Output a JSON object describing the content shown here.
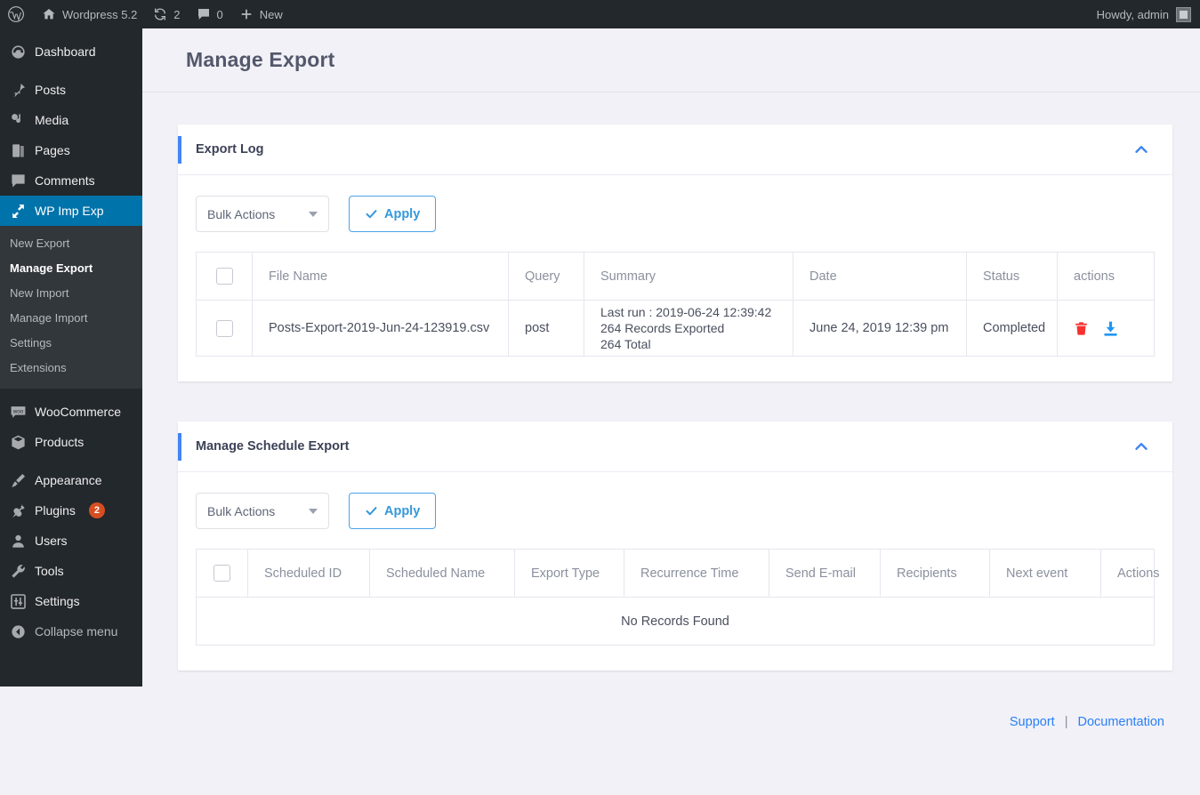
{
  "adminbar": {
    "logo_icon": "wordpress-logo-icon",
    "site_name": "Wordpress 5.2",
    "home_icon": "home-icon",
    "updates_icon": "updates-icon",
    "updates_count": "2",
    "comments_icon": "comment-icon",
    "comments_count": "0",
    "new_icon": "plus-icon",
    "new_label": "New",
    "howdy": "Howdy, admin",
    "avatar_icon": "avatar-icon"
  },
  "sidebar": {
    "items": [
      {
        "label": "Dashboard",
        "icon": "dashboard-icon"
      },
      {
        "label": "Posts",
        "icon": "pin-icon"
      },
      {
        "label": "Media",
        "icon": "media-icon"
      },
      {
        "label": "Pages",
        "icon": "pages-icon"
      },
      {
        "label": "Comments",
        "icon": "comment-icon"
      },
      {
        "label": "WP Imp Exp",
        "icon": "import-export-icon"
      },
      {
        "label": "WooCommerce",
        "icon": "woocommerce-icon"
      },
      {
        "label": "Products",
        "icon": "box-icon"
      },
      {
        "label": "Appearance",
        "icon": "brush-icon"
      },
      {
        "label": "Plugins",
        "icon": "plug-icon",
        "badge": "2"
      },
      {
        "label": "Users",
        "icon": "user-icon"
      },
      {
        "label": "Tools",
        "icon": "wrench-icon"
      },
      {
        "label": "Settings",
        "icon": "settings-icon"
      },
      {
        "label": "Collapse menu",
        "icon": "collapse-icon"
      }
    ],
    "submenu": [
      {
        "label": "New Export",
        "active": false
      },
      {
        "label": "Manage Export",
        "active": true
      },
      {
        "label": "New Import",
        "active": false
      },
      {
        "label": "Manage Import",
        "active": false
      },
      {
        "label": "Settings",
        "active": false
      },
      {
        "label": "Extensions",
        "active": false
      }
    ]
  },
  "header": {
    "title": "Manage Export"
  },
  "colors": {
    "accent_blue": "#4285f4",
    "link_blue": "#2a7ff6",
    "button_blue": "#3498db",
    "delete_red": "#f8312f",
    "download_blue": "#2196f3",
    "admin_dark": "#23282d",
    "menu_active": "#0073aa",
    "badge_orange": "#d54e21"
  },
  "export_log": {
    "title": "Export Log",
    "collapse_icon": "chevron-up-icon",
    "bulk_actions_label": "Bulk Actions",
    "dropdown_icon": "chevron-down-icon",
    "apply_label": "Apply",
    "apply_icon": "check-icon",
    "select_all_icon": "checkbox-icon",
    "columns": [
      "File Name",
      "Query",
      "Summary",
      "Date",
      "Status",
      "actions"
    ],
    "rows": [
      {
        "file_name": "Posts-Export-2019-Jun-24-123919.csv",
        "query": "post",
        "summary_line1": "Last run : 2019-06-24 12:39:42",
        "summary_line2": "264 Records Exported",
        "summary_line3": "264 Total",
        "date": "June 24, 2019 12:39 pm",
        "status": "Completed",
        "delete_icon": "trash-icon",
        "download_icon": "download-icon"
      }
    ]
  },
  "schedule_export": {
    "title": "Manage Schedule Export",
    "collapse_icon": "chevron-up-icon",
    "bulk_actions_label": "Bulk Actions",
    "dropdown_icon": "chevron-down-icon",
    "apply_label": "Apply",
    "apply_icon": "check-icon",
    "select_all_icon": "checkbox-icon",
    "columns": [
      "Scheduled ID",
      "Scheduled Name",
      "Export Type",
      "Recurrence Time",
      "Send E-mail",
      "Recipients",
      "Next event",
      "Actions"
    ],
    "empty_message": "No Records Found"
  },
  "footer": {
    "support": "Support",
    "separator": "|",
    "documentation": "Documentation"
  }
}
